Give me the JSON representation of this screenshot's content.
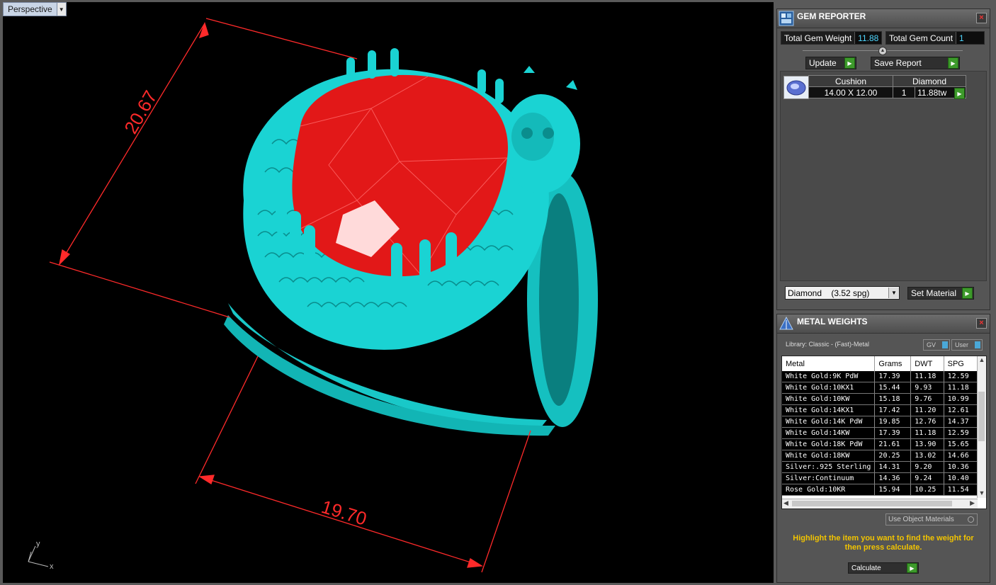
{
  "viewport": {
    "label": "Perspective",
    "dim1": "20.67",
    "dim2": "19.70",
    "axis_y": "y",
    "axis_x": "x"
  },
  "gem_reporter": {
    "title": "GEM REPORTER",
    "total_weight_label": "Total Gem Weight",
    "total_weight_value": "11.88",
    "total_count_label": "Total Gem Count",
    "total_count_value": "1",
    "update_label": "Update",
    "save_report_label": "Save Report",
    "table_header": {
      "shape": "Cushion",
      "type": "Diamond"
    },
    "table_row": {
      "size": "14.00 X 12.00",
      "qty": "1",
      "weight": "11.88tw"
    },
    "material_select": "Diamond    (3.52 spg)",
    "set_material_label": "Set Material"
  },
  "metal_weights": {
    "title": "METAL WEIGHTS",
    "library": "Library: Classic - (Fast)-Metal",
    "toggle_gv": "GV",
    "toggle_user": "User",
    "columns": [
      "Metal",
      "Grams",
      "DWT",
      "SPG"
    ],
    "rows": [
      [
        "White Gold:9K PdW",
        "17.39",
        "11.18",
        "12.59"
      ],
      [
        "White Gold:10KX1",
        "15.44",
        "9.93",
        "11.18"
      ],
      [
        "White Gold:10KW",
        "15.18",
        "9.76",
        "10.99"
      ],
      [
        "White Gold:14KX1",
        "17.42",
        "11.20",
        "12.61"
      ],
      [
        "White Gold:14K PdW",
        "19.85",
        "12.76",
        "14.37"
      ],
      [
        "White Gold:14KW",
        "17.39",
        "11.18",
        "12.59"
      ],
      [
        "White Gold:18K PdW",
        "21.61",
        "13.90",
        "15.65"
      ],
      [
        "White Gold:18KW",
        "20.25",
        "13.02",
        "14.66"
      ],
      [
        "Silver:.925 Sterling",
        "14.31",
        "9.20",
        "10.36"
      ],
      [
        "Silver:Continuum",
        "14.36",
        "9.24",
        "10.40"
      ],
      [
        "Rose Gold:10KR",
        "15.94",
        "10.25",
        "11.54"
      ]
    ],
    "use_object_materials": "Use Object Materials",
    "hint": "Highlight the item you want to find the weight for then press calculate.",
    "calculate_label": "Calculate"
  },
  "colors": {
    "ring": "#19d8d8",
    "gem": "#e21818",
    "dimension": "#ff2a2a",
    "hint": "#f2c400",
    "go_button": "#3d9a2b"
  }
}
